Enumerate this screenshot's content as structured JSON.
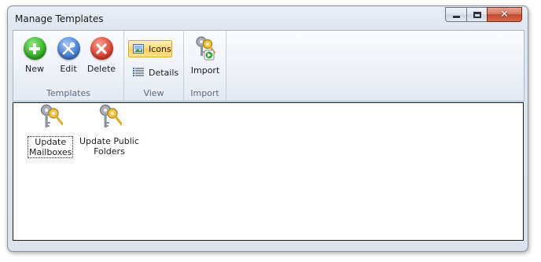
{
  "window": {
    "title": "Manage Templates",
    "close_glyph": "✕"
  },
  "ribbon": {
    "groups": [
      {
        "label": "Templates"
      },
      {
        "label": "View"
      },
      {
        "label": "Import"
      }
    ],
    "templates": {
      "new_label": "New",
      "edit_label": "Edit",
      "delete_label": "Delete"
    },
    "view": {
      "icons_label": "Icons",
      "details_label": "Details",
      "selected": "Icons"
    },
    "import": {
      "import_label": "Import"
    }
  },
  "items": [
    {
      "line1": "Update",
      "line2": "Mailboxes",
      "icon": "keys-icon",
      "focused": true
    },
    {
      "line1": "Update Public",
      "line2": "Folders",
      "icon": "keys-icon",
      "focused": false
    }
  ],
  "colors": {
    "accent_selected": "#ffd96e",
    "new": "#3cb82c",
    "edit": "#4b86dd",
    "delete": "#e24a38"
  }
}
